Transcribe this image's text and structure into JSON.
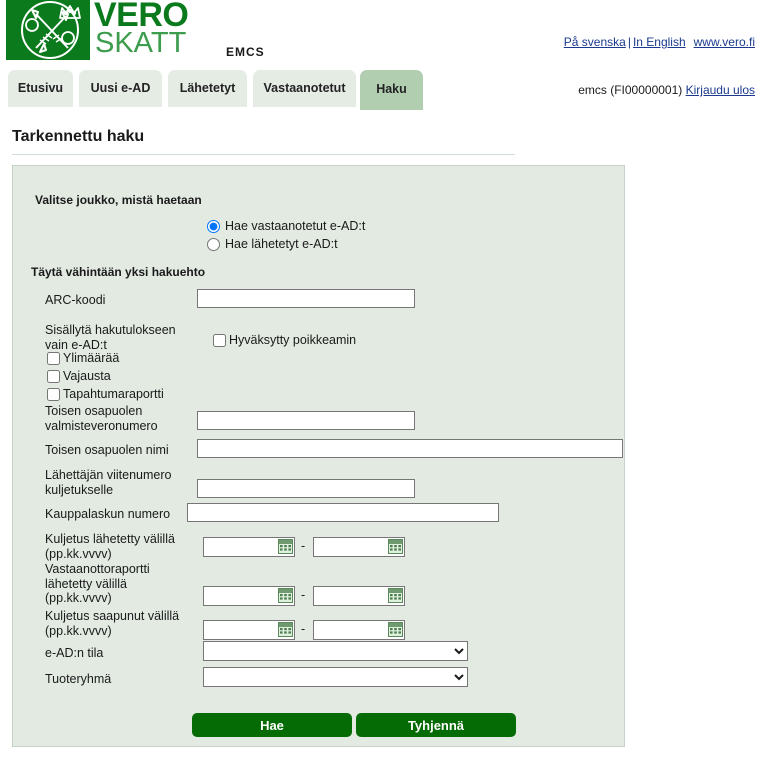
{
  "header": {
    "logo_vero": "VERO",
    "logo_skatt": "SKATT",
    "app_name": "EMCS",
    "links": {
      "swedish": "På svenska",
      "separator": "|",
      "english": "In English",
      "website": "www.vero.fi"
    },
    "user": {
      "account": "emcs (FI00000001)",
      "logout": "Kirjaudu ulos"
    }
  },
  "tabs": [
    {
      "label": "Etusivu",
      "active": false
    },
    {
      "label": "Uusi e-AD",
      "active": false
    },
    {
      "label": "Lähetetyt",
      "active": false
    },
    {
      "label": "Vastaanotetut",
      "active": false
    },
    {
      "label": "Haku",
      "active": true
    }
  ],
  "page": {
    "title": "Tarkennettu haku"
  },
  "form": {
    "legend_scope": "Valitse joukko, mistä haetaan",
    "legend_criteria": "Täytä vähintään yksi hakuehto",
    "scope_options": [
      {
        "label": "Hae vastaanotetut e-AD:t",
        "checked": true
      },
      {
        "label": "Hae lähetetyt e-AD:t",
        "checked": false
      }
    ],
    "fields": {
      "arc_code": {
        "label": "ARC-koodi",
        "value": ""
      },
      "include_only": {
        "label": "Sisällytä hakutulokseen vain e-AD:t"
      },
      "approved_deviation": {
        "label": "Hyväksytty poikkeamin",
        "checked": false
      },
      "excess": {
        "label": "Ylimäärää",
        "checked": false
      },
      "shortage": {
        "label": "Vajausta",
        "checked": false
      },
      "event_report": {
        "label": "Tapahtumaraportti",
        "checked": false
      },
      "counterparty_excise_number": {
        "label": "Toisen osapuolen valmisteveronumero",
        "value": ""
      },
      "counterparty_name": {
        "label": "Toisen osapuolen nimi",
        "value": ""
      },
      "consignor_reference": {
        "label": "Lähettäjän viitenumero kuljetukselle",
        "value": ""
      },
      "invoice_number": {
        "label": "Kauppalaskun numero",
        "value": ""
      },
      "dispatch_between": {
        "label": "Kuljetus lähetetty välillä (pp.kk.vvvv)",
        "from": "",
        "to": ""
      },
      "report_sent_between": {
        "label": "Vastaanottoraportti lähetetty välillä (pp.kk.vvvv)",
        "from": "",
        "to": ""
      },
      "arrival_between": {
        "label": "Kuljetus saapunut välillä (pp.kk.vvvv)",
        "from": "",
        "to": ""
      },
      "ead_state": {
        "label": "e-AD:n tila",
        "value": "",
        "options": [
          ""
        ]
      },
      "product_group": {
        "label": "Tuoteryhmä",
        "value": "",
        "options": [
          ""
        ]
      }
    },
    "date_separator": "-",
    "buttons": {
      "search": "Hae",
      "clear": "Tyhjennä"
    }
  },
  "colors": {
    "brand_green": "#0a7a1c",
    "logo_secondary": "#3d9c4e",
    "panel_bg": "#e2eae2",
    "tab_inactive": "#e4ece4",
    "tab_active": "#b1ceb1",
    "button_green": "#056b05",
    "link_blue": "#1b3a8f"
  }
}
